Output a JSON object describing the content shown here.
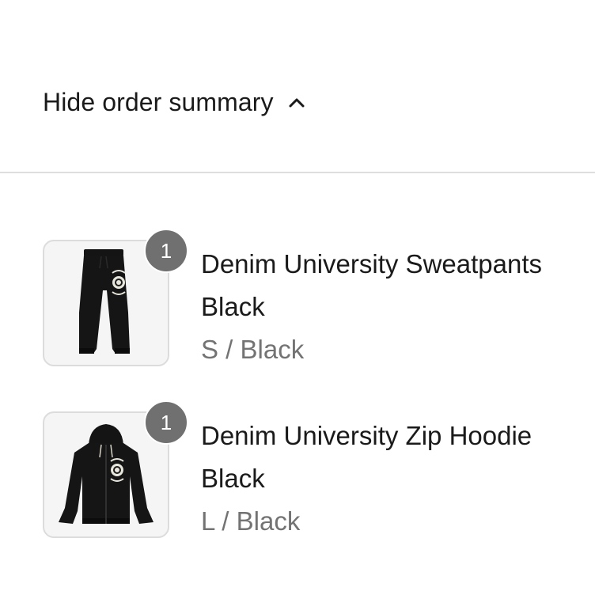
{
  "order_summary": {
    "toggle_label": "Hide order summary",
    "toggle_icon": "chevron-up-icon"
  },
  "items": [
    {
      "quantity": "1",
      "name_line1": "Denim University Sweatpants",
      "name_line2": "Black",
      "variant": "S / Black",
      "thumbnail": "sweatpants-image"
    },
    {
      "quantity": "1",
      "name_line1": "Denim University Zip Hoodie",
      "name_line2": "Black",
      "variant": "L / Black",
      "thumbnail": "zip-hoodie-image"
    }
  ],
  "colors": {
    "text": "#1a1a1a",
    "muted_text": "#737373",
    "badge": "#707070",
    "divider": "#dedede",
    "thumb_bg": "#f5f5f5"
  }
}
